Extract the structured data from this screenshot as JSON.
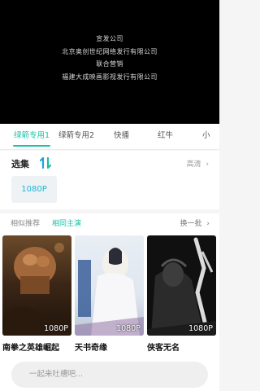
{
  "video": {
    "credits": [
      "宣发公司",
      "北京奥创世纪网络发行有限公司",
      "联合营销",
      "福建大成映画影视发行有限公司"
    ]
  },
  "source_tabs": [
    {
      "label": "绿箭专用1",
      "active": true
    },
    {
      "label": "绿箭专用2",
      "active": false
    },
    {
      "label": "快播",
      "active": false
    },
    {
      "label": "红牛",
      "active": false
    },
    {
      "label": "小",
      "active": false
    }
  ],
  "episodes": {
    "title": "选集",
    "quality_label": "高清",
    "items": [
      "1080P"
    ]
  },
  "recommend": {
    "tab_similar": "相似推荐",
    "tab_same_cast": "相同主演",
    "refresh_label": "换一批",
    "cards": [
      {
        "title": "南拳之英雄崛起",
        "badge": "1080P",
        "poster_text": "英雄崛起"
      },
      {
        "title": "天书奇缘",
        "badge": "1080P",
        "poster_text": "天书奇缘"
      },
      {
        "title": "侠客无名",
        "badge": "1080P",
        "poster_text": "侠客无名"
      }
    ]
  },
  "comment": {
    "placeholder": "一起来吐槽吧..."
  },
  "colors": {
    "accent": "#19c3a6",
    "episode_text": "#19b8d6"
  }
}
